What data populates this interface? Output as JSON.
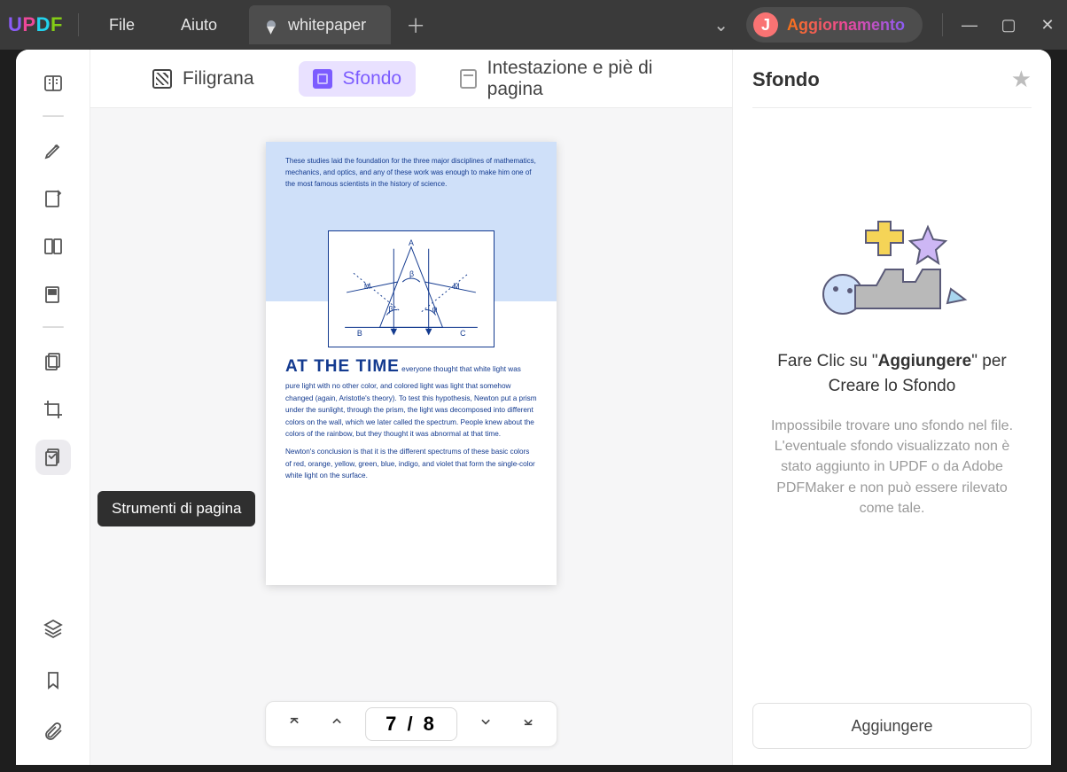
{
  "titlebar": {
    "menu_file": "File",
    "menu_help": "Aiuto",
    "tab_title": "whitepaper",
    "cta_avatar_letter": "J",
    "cta_text": "Aggiornamento"
  },
  "sidebar": {
    "tooltip": "Strumenti di pagina"
  },
  "toolbar": {
    "filigrana": "Filigrana",
    "sfondo": "Sfondo",
    "intest": "Intestazione e piè di pagina"
  },
  "page": {
    "intro": "These studies laid the foundation for the three major disciplines of mathematics, mechanics, and optics, and any of these work was enough to make him one of the most famous scientists in the history of science.",
    "heading": "AT THE TIME",
    "body1": "everyone thought that white light was pure light with no other color, and colored light was light that somehow changed (again, Aristotle's theory). To test this hypothesis, Newton put a prism under the sunlight, through the prism, the light was decomposed into different colors on the wall, which we later called the spectrum. People knew about the colors of the rainbow, but they thought it was abnormal at that time.",
    "body2": "Newton's conclusion is that it is the different spectrums of these basic colors of red, orange, yellow, green, blue, indigo, and violet that form the single-color white light on the surface.",
    "diagram_labels": {
      "A": "A",
      "B": "B",
      "C": "C",
      "M": "M",
      "beta": "β",
      "phi": "φ"
    }
  },
  "pager": {
    "current": "7",
    "total": "8"
  },
  "panel": {
    "title": "Sfondo",
    "desc_pre": "Fare Clic su \"",
    "desc_bold": "Aggiungere",
    "desc_post": "\" per Creare lo Sfondo",
    "note": "Impossibile trovare uno sfondo nel file. L'eventuale sfondo visualizzato non è stato aggiunto in UPDF o da Adobe PDFMaker e non può essere rilevato come tale.",
    "add_button": "Aggiungere"
  }
}
